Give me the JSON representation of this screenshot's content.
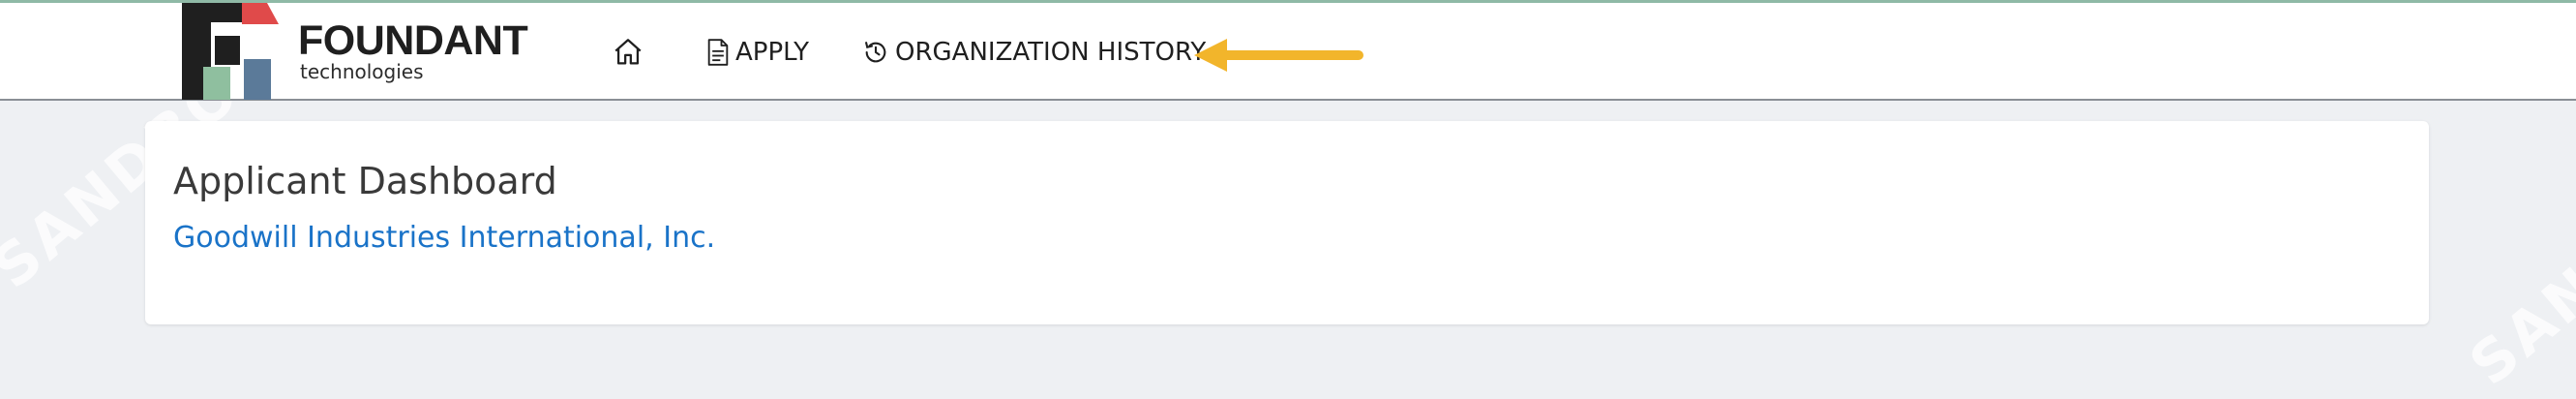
{
  "brand": {
    "name": "FOUNDANT",
    "tagline": "technologies",
    "colors": {
      "black": "#1f1f1f",
      "red": "#e04a4a",
      "green": "#8fbf9f",
      "blue": "#5b7a99"
    }
  },
  "nav": {
    "home_icon": "home-icon",
    "apply": {
      "icon": "document-icon",
      "label": "APPLY"
    },
    "history": {
      "icon": "history-icon",
      "label": "ORGANIZATION HISTORY"
    }
  },
  "annotation": {
    "icon": "arrow-left-icon",
    "color": "#f2b52b"
  },
  "main": {
    "title": "Applicant Dashboard",
    "organization": "Goodwill Industries International, Inc."
  },
  "watermark": {
    "text": "SANDBOX"
  },
  "colors": {
    "link": "#1a73c8",
    "background": "#eef0f3"
  }
}
